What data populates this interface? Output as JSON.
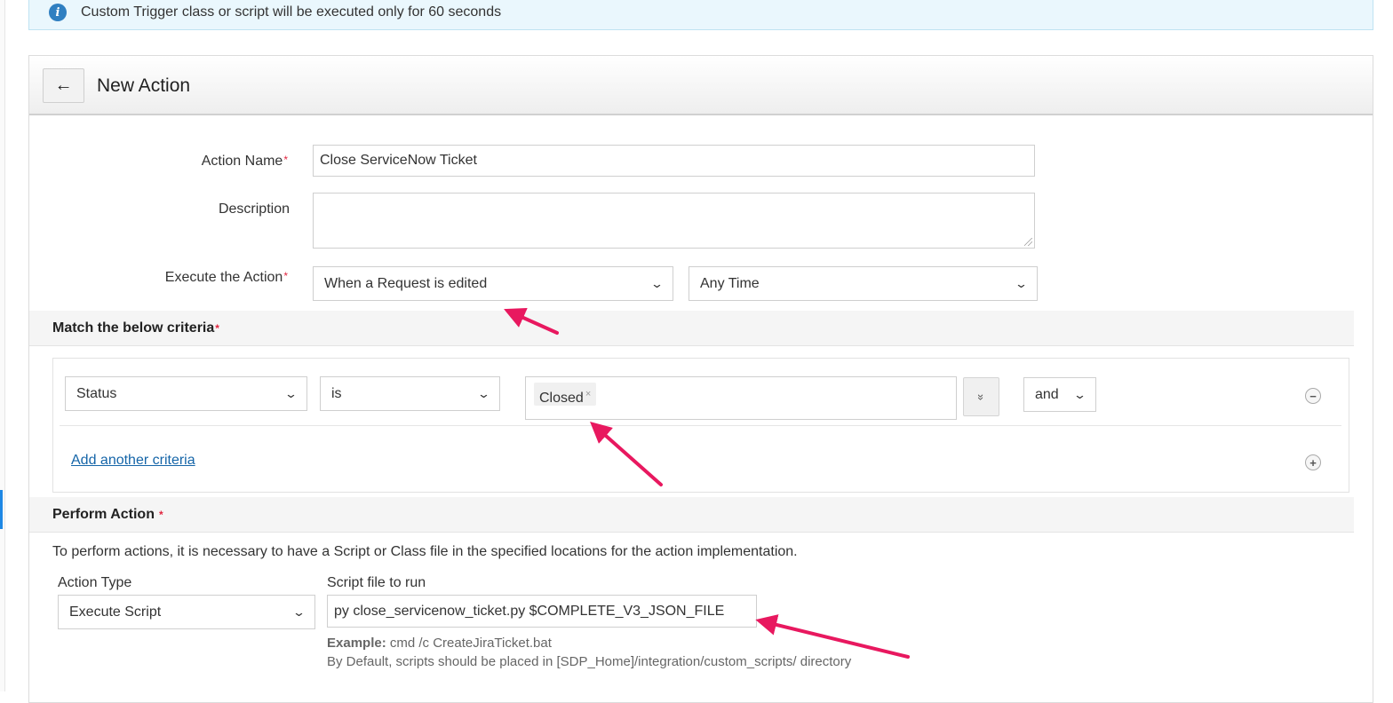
{
  "banner": {
    "text": "Custom Trigger class or script will be executed only for 60 seconds",
    "icon": "info-icon"
  },
  "header": {
    "back_icon": "←",
    "title": "New Action"
  },
  "form": {
    "action_name_label": "Action Name",
    "action_name_value": "Close ServiceNow Ticket",
    "description_label": "Description",
    "description_value": "",
    "execute_label": "Execute the Action",
    "execute_event": "When a Request is edited",
    "execute_time": "Any Time",
    "required_mark": "*"
  },
  "criteria": {
    "title": "Match the below criteria",
    "field": "Status",
    "operator": "is",
    "values": [
      "Closed"
    ],
    "remove_tag_icon": "×",
    "expand_icon": "»",
    "conjunction": "and",
    "remove_icon": "−",
    "add_icon": "+",
    "add_link": "Add another criteria"
  },
  "perform": {
    "title": "Perform Action",
    "note": "To perform actions, it is necessary to have a Script or Class file in the specified locations for the action implementation.",
    "action_type_label": "Action Type",
    "action_type_value": "Execute Script",
    "script_label": "Script file to run",
    "script_value": "py close_servicenow_ticket.py $COMPLETE_V3_JSON_FILE",
    "example_label": "Example:",
    "example_value": "cmd /c CreateJiraTicket.bat",
    "default_note": "By Default, scripts should be placed in [SDP_Home]/integration/custom_scripts/ directory"
  },
  "colors": {
    "accent": "#e8185f",
    "link": "#1565a8",
    "required": "#e0253f",
    "banner_bg": "#eaf7fd"
  }
}
